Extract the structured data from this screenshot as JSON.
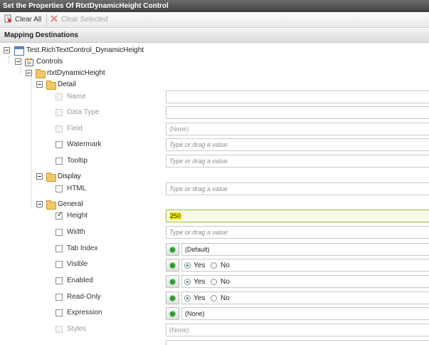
{
  "title": "Set the Properties Of RtxtDynamicHeight Control",
  "toolbar": {
    "clear_all": "Clear All",
    "clear_selected": "Clear Selected"
  },
  "section": "Mapping Destinations",
  "tree": {
    "root": "Test.RichTextControl_DynamicHeight",
    "controls": "Controls",
    "control": "rtxtDynamicHeight",
    "detail": "Detail",
    "display": "Display",
    "general": "General"
  },
  "properties": {
    "name": {
      "label": "Name",
      "value": ""
    },
    "data_type": {
      "label": "Data Type",
      "value": ""
    },
    "field": {
      "label": "Field",
      "value": "(None)"
    },
    "watermark": {
      "label": "Watermark",
      "placeholder": "Type or drag a value"
    },
    "tooltip": {
      "label": "Tooltip",
      "placeholder": "Type or drag a value"
    },
    "html": {
      "label": "HTML",
      "placeholder": "Type or drag a value"
    },
    "height": {
      "label": "Height",
      "value": "250",
      "checked": true
    },
    "width": {
      "label": "Width",
      "placeholder": "Type or drag a value"
    },
    "tab_index": {
      "label": "Tab Index",
      "value": "(Default)"
    },
    "visible": {
      "label": "Visible",
      "yes": "Yes",
      "no": "No"
    },
    "enabled": {
      "label": "Enabled",
      "yes": "Yes",
      "no": "No"
    },
    "read_only": {
      "label": "Read-Only",
      "yes": "Yes",
      "no": "No"
    },
    "expression": {
      "label": "Expression",
      "value": "(None)"
    },
    "styles": {
      "label": "Styles",
      "value": "(None)"
    }
  },
  "colors": {
    "titlebar": "#4a4a4a",
    "highlight": "#fff200",
    "active_border": "#95c03a",
    "bind_green": "#2f9b2f"
  },
  "icons": [
    "clear-all-icon",
    "clear-selected-icon",
    "form-icon",
    "controls-icon",
    "folder-icon"
  ]
}
